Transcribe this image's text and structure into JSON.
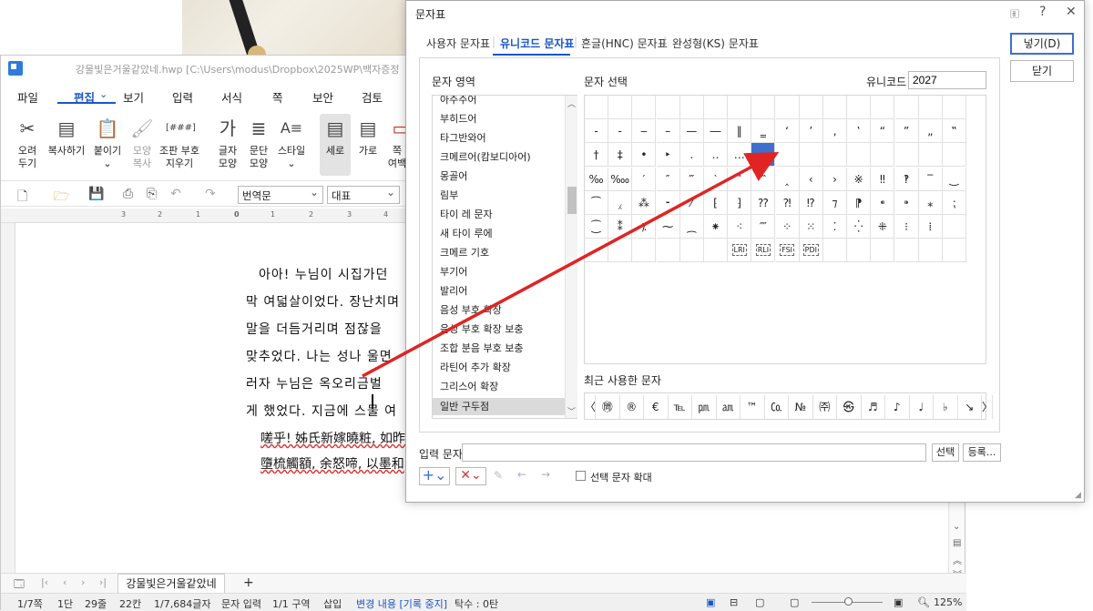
{
  "editor": {
    "title": "강물빛은거울같았네.hwp [C:\\Users\\modus\\Dropbox\\2025WP\\백자증정",
    "menus": [
      "파일",
      "편집",
      "보기",
      "입력",
      "서식",
      "쪽",
      "보안",
      "검토"
    ],
    "active_menu": "편집",
    "ribbon": [
      {
        "label1": "오려",
        "label2": "두기",
        "icon": "✂"
      },
      {
        "label1": "복사하기",
        "label2": "",
        "icon": "▤"
      },
      {
        "label1": "붙이기",
        "label2": "⌄",
        "icon": "📋"
      },
      {
        "label1": "모양",
        "label2": "복사",
        "icon": "🖌"
      },
      {
        "label1": "조판 부호",
        "label2": "지우기",
        "icon": "[###]"
      },
      {
        "label1": "글자",
        "label2": "모양",
        "icon": "가"
      },
      {
        "label1": "문단",
        "label2": "모양",
        "icon": "≣"
      },
      {
        "label1": "스타일",
        "label2": "⌄",
        "icon": "A≡"
      },
      {
        "label1": "세로",
        "label2": "",
        "icon": "▤"
      },
      {
        "label1": "가로",
        "label2": "",
        "icon": "▤"
      },
      {
        "label1": "쪽",
        "label2": "여백",
        "icon": "▭"
      }
    ],
    "style_combo": "번역문",
    "font_combo": "대표",
    "ruler_marks": [
      "3",
      "2",
      "1",
      "0",
      "1",
      "2",
      "3",
      "4"
    ],
    "lines": [
      "아아! 누님이 시집가던",
      "막 여덟살이었다. 장난치며",
      "말을 더듬거리며 점잖을",
      "맞추었다. 나는 성나 울면",
      "러자 누님은 옥오리금벌",
      "게 했었다. 지금에 스물 여"
    ],
    "hanja_lines": [
      "嗟乎! 姊氏新嫁曉粧, 如昨",
      "墮梳觸額, 余怒啼, 以墨和"
    ],
    "doc_tab": "강물빛은거울같았네",
    "status": {
      "page": "1/7쪽",
      "dan": "1단",
      "line": "29줄",
      "col": "22칸",
      "chars": "1/7,684글자",
      "mode": "문자 입력",
      "section": "1/1 구역",
      "insert": "삽입",
      "track": "변경 내용 [기록 중지]",
      "tabs": "탁수 : 0탄",
      "zoom": "125%"
    }
  },
  "dialog": {
    "title": "문자표",
    "tabs": [
      "사용자 문자표",
      "유니코드 문자표",
      "흔글(HNC) 문자표",
      "완성형(KS) 문자표"
    ],
    "active_tab": "유니코드 문자표",
    "area_label": "문자 영역",
    "select_label": "문자 선택",
    "unicode_label": "유니코드",
    "unicode_value": "2027",
    "insert_button": "넣기(D)",
    "close_button": "닫기",
    "areas": [
      "아주주어",
      "부히드어",
      "타그반와어",
      "크메르어(캄보디아어)",
      "몽골어",
      "림부",
      "타이 레 문자",
      "새 타이 루에",
      "크메르 기호",
      "부기어",
      "발리어",
      "음성 부호 확장",
      "음성 부호 확장 보충",
      "조합 분음 부호 보충",
      "라틴어 추가 확장",
      "그리스어 확장",
      "일반 구두점"
    ],
    "selected_area": "일반 구두점",
    "grid_rows": [
      [
        " ",
        " ",
        " ",
        " ",
        " ",
        " ",
        " ",
        " ",
        " ",
        " ",
        " ",
        " ",
        " ",
        " ",
        " ",
        " ",
        " "
      ],
      [
        "‐",
        "‑",
        "‒",
        "–",
        "—",
        "―",
        "‖",
        "‗",
        "‘",
        "’",
        "‚",
        "‛",
        "“",
        "”",
        "„",
        "‟"
      ],
      [
        "†",
        "‡",
        "•",
        "‣",
        "․",
        "‥",
        "…",
        "‧",
        "",
        "",
        "",
        "",
        "",
        "",
        "",
        ""
      ],
      [
        "‰",
        "‱",
        "′",
        "″",
        "‴",
        "‵",
        "‶",
        "‷",
        "‸",
        "‹",
        "›",
        "※",
        "‼",
        "‽",
        "‾",
        "‿"
      ],
      [
        "⁀",
        "⁁",
        "⁂",
        "⁃",
        "⁄",
        "⁅",
        "⁆",
        "⁇",
        "⁈",
        "⁉",
        "⁊",
        "⁋",
        "⁌",
        "⁍",
        "⁎",
        "⁏"
      ],
      [
        "⁐",
        "⁑",
        "⁒",
        "⁓",
        "⁔",
        "⁕",
        "⁖",
        "⁗",
        "⁘",
        "⁙",
        "⁚",
        "⁛",
        "⁜",
        "⁝",
        "⁞",
        ""
      ],
      [
        "",
        "",
        "",
        "",
        "",
        "",
        "",
        "",
        "",
        "",
        "",
        "",
        "",
        "",
        "",
        ""
      ]
    ],
    "grid_special": [
      "LRI",
      "RLI",
      "FSI",
      "PDI"
    ],
    "selected_char": "‧",
    "recent_label": "최근 사용한 문자",
    "recent": [
      "〈",
      "㉄",
      "®",
      "€",
      "℡",
      "㏘",
      "㏂",
      "™",
      "㏇",
      "№",
      "㈜",
      "㉿",
      "♬",
      "♪",
      "♩",
      "♭",
      "↘",
      "〉"
    ],
    "input_label": "입력 문자",
    "select_button": "선택",
    "register_button": "등록...",
    "enlarge_label": "선택 문자 확대"
  },
  "colors": {
    "accent": "#1a55c8",
    "selection": "#3d6fcf",
    "arrow": "#e02424"
  }
}
